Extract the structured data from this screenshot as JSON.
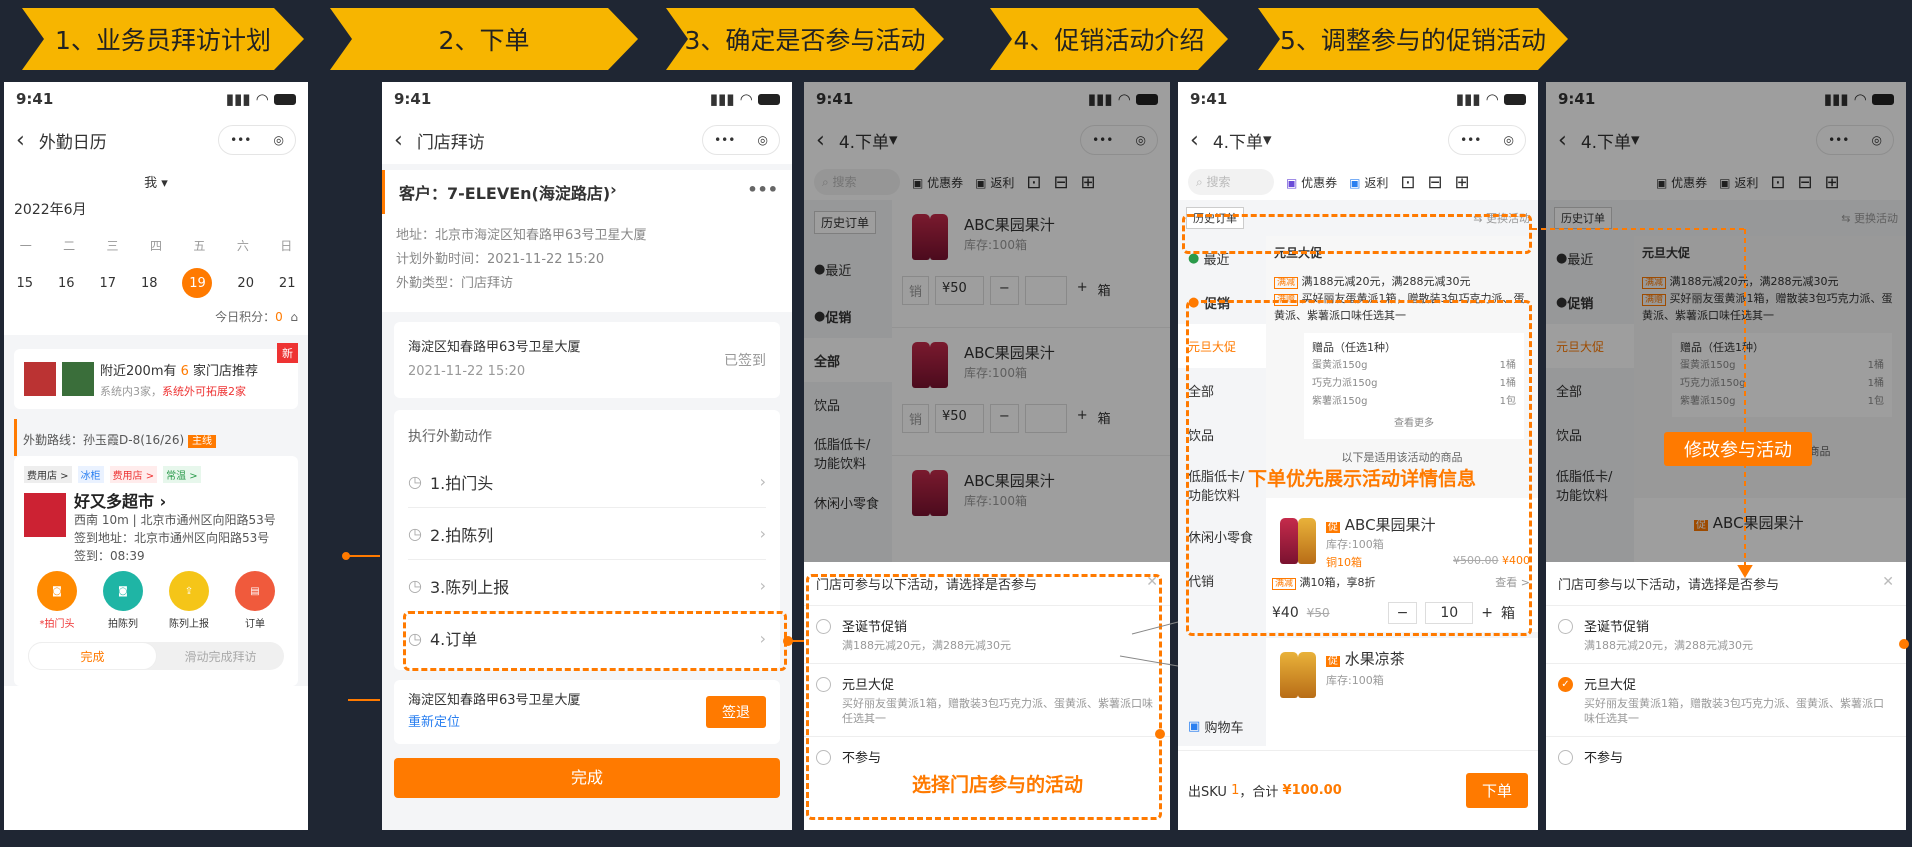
{
  "steps": [
    "1、业务员拜访计划",
    "2、下单",
    "3、确定是否参与活动",
    "4、促销活动介绍",
    "5、调整参与的促销活动"
  ],
  "time": "9:41",
  "p1": {
    "title": "外勤日历",
    "me": "我",
    "month": "2022年6月",
    "weekdays": [
      "一",
      "二",
      "三",
      "四",
      "五",
      "六",
      "日"
    ],
    "days": [
      "15",
      "16",
      "17",
      "18",
      "19",
      "20",
      "21"
    ],
    "points_label": "今日积分：",
    "points": "0",
    "rec_badge": "新",
    "rec_a": "附近200m有",
    "rec_num": "6",
    "rec_b": "家门店推荐",
    "rec_sub_a": "系统内3家，",
    "rec_sub_b": "系统外可拓展2家",
    "route": "外勤路线：孙玉霞D-8(16/26)",
    "route_tag": "主线",
    "tags": [
      "费用店 >",
      "冰柜",
      "费用店 >",
      "常温 >"
    ],
    "store": "好又多超市",
    "addr1": "西南 10m | 北京市通州区向阳路53号",
    "addr2": "签到地址：北京市通州区向阳路53号",
    "addr3": "签到：08:39",
    "actions": [
      "*拍门头",
      "拍陈列",
      "陈列上报",
      "订单"
    ],
    "done": "完成",
    "slide": "滑动完成拜访"
  },
  "p2": {
    "title": "门店拜访",
    "customer": "客户：7-ELEVEn(海淀路店)",
    "addr": "地址：北京市海淀区知春路甲63号卫星大厦",
    "plan": "计划外勤时间：2021-11-22 15:20",
    "type": "外勤类型：门店拜访",
    "sign_addr": "海淀区知春路甲63号卫星大厦",
    "sign_time": "2021-11-22 15:20",
    "signed": "已签到",
    "exec": "执行外勤动作",
    "items": [
      "1.拍门头",
      "2.拍陈列",
      "3.陈列上报",
      "4.订单"
    ],
    "out_addr": "海淀区知春路甲63号卫星大厦",
    "relocate": "重新定位",
    "checkout": "签退",
    "done": "完成"
  },
  "order": {
    "title": "4.下单",
    "search": "搜索",
    "coupon": "优惠券",
    "rebate": "返利",
    "history": "历史订单",
    "switch": "⇆ 更换活动",
    "side": [
      "最近",
      "促销",
      "全部",
      "饮品",
      "低脂低卡/功能饮料",
      "休闲小零食",
      "代销"
    ],
    "side4": [
      "最近",
      "促销",
      "元旦大促",
      "全部",
      "饮品",
      "低脂低卡/功能饮料",
      "休闲小零食",
      "代销"
    ],
    "product": "ABC果园果汁",
    "stock": "库存:100箱",
    "sell": "销",
    "price": "¥50",
    "unit": "箱",
    "cart": "购物车",
    "sku_a": "出SKU",
    "sku_n": "1",
    "sku_b": "，合计",
    "total": "¥100.00",
    "submit": "下单"
  },
  "promo": {
    "name": "元旦大促",
    "rule1_tag": "满减",
    "rule1": "满188元减20元，满288元减30元",
    "rule2_tag": "满赠",
    "rule2": "买好丽友蛋黄派1箱，赠散装3包巧克力派、蛋黄派、紫薯派口味任选其一",
    "gift_title": "赠品（任选1种）",
    "gifts": [
      [
        "蛋黄派150g",
        "1桶"
      ],
      [
        "巧克力派150g",
        "1桶"
      ],
      [
        "紫薯派150g",
        "1包"
      ]
    ],
    "more": "查看更多",
    "apply": "以下是适用该活动的商品",
    "p_name": "ABC果园果汁",
    "p_stock": "库存:100箱",
    "p_pack": "铜10箱",
    "p_old": "¥500.00",
    "p_new": "¥400",
    "p_rule_tag": "满减",
    "p_rule": "满10箱，享8折",
    "p_look": "查看 >",
    "p_price": "¥40",
    "p_oldp": "¥50",
    "qty": "10",
    "p_unit": "箱",
    "p2_name": "水果凉茶",
    "p2_stock": "库存:100箱"
  },
  "sheet": {
    "title": "门店可参与以下活动，请选择是否参与",
    "o1": "圣诞节促销",
    "o1s": "满188元减20元，满288元减30元",
    "o2": "元旦大促",
    "o2s": "买好丽友蛋黄派1箱，赠散装3包巧克力派、蛋黄派、紫薯派口味任选其一",
    "o3": "不参与"
  },
  "ann": {
    "a3": "选择门店参与的活动",
    "a4": "下单优先展示活动详情信息",
    "a5": "修改参与活动"
  },
  "colors": {
    "accent": "#ff7a00",
    "arrow": "#f7b500",
    "bg": "#1f2633"
  }
}
